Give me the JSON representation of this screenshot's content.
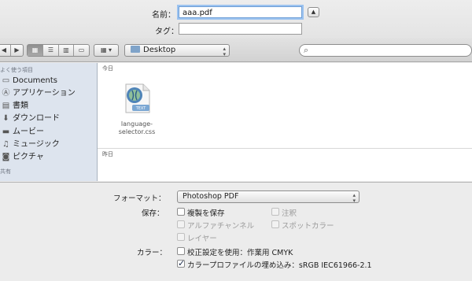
{
  "header": {
    "name_label": "名前：",
    "name_value": "aaa.pdf",
    "tags_label": "タグ：",
    "tags_value": "",
    "expand_icon": "chevron-up-icon",
    "expand_glyph": "▲"
  },
  "toolbar": {
    "back_glyph": "◀",
    "forward_glyph": "▶",
    "view_icons": [
      "▦",
      "☰",
      "▥",
      "▭"
    ],
    "arrange_glyph": "▦ ▾",
    "location": "Desktop",
    "search_glyph": "⌕"
  },
  "sidebar": {
    "heading": "よく使う項目",
    "items": [
      {
        "label": "Documents",
        "icon": "folder-icon",
        "glyph": "▭"
      },
      {
        "label": "アプリケーション",
        "icon": "applications-icon",
        "glyph": "Ⓐ"
      },
      {
        "label": "書類",
        "icon": "documents-icon",
        "glyph": "▤"
      },
      {
        "label": "ダウンロード",
        "icon": "download-icon",
        "glyph": "⬇"
      },
      {
        "label": "ムービー",
        "icon": "movie-icon",
        "glyph": "▬"
      },
      {
        "label": "ミュージック",
        "icon": "music-icon",
        "glyph": "♫"
      },
      {
        "label": "ピクチャ",
        "icon": "camera-icon",
        "glyph": "◙"
      }
    ],
    "next_heading": "共有"
  },
  "files": {
    "today_header": "今日",
    "yesterday_header": "昨日",
    "items": [
      {
        "name": "language-selector.css",
        "line1": "language-",
        "line2": "selector.css",
        "badge": "TEXT"
      }
    ]
  },
  "options": {
    "format_label": "フォーマット：",
    "format_value": "Photoshop PDF",
    "save_label": "保存：",
    "color_label": "カラー：",
    "checkboxes": [
      {
        "label": "複製を保存",
        "checked": false,
        "disabled": false
      },
      {
        "label": "注釈",
        "checked": false,
        "disabled": true
      },
      {
        "label": "アルファチャンネル",
        "checked": false,
        "disabled": true
      },
      {
        "label": "スポットカラー",
        "checked": false,
        "disabled": true
      },
      {
        "label": "レイヤー",
        "checked": false,
        "disabled": true
      },
      {
        "label": "校正設定を使用：作業用 CMYK",
        "checked": false,
        "disabled": false
      },
      {
        "label": "カラープロファイルの埋め込み：sRGB IEC61966-2.1",
        "checked": true,
        "disabled": false
      }
    ]
  }
}
